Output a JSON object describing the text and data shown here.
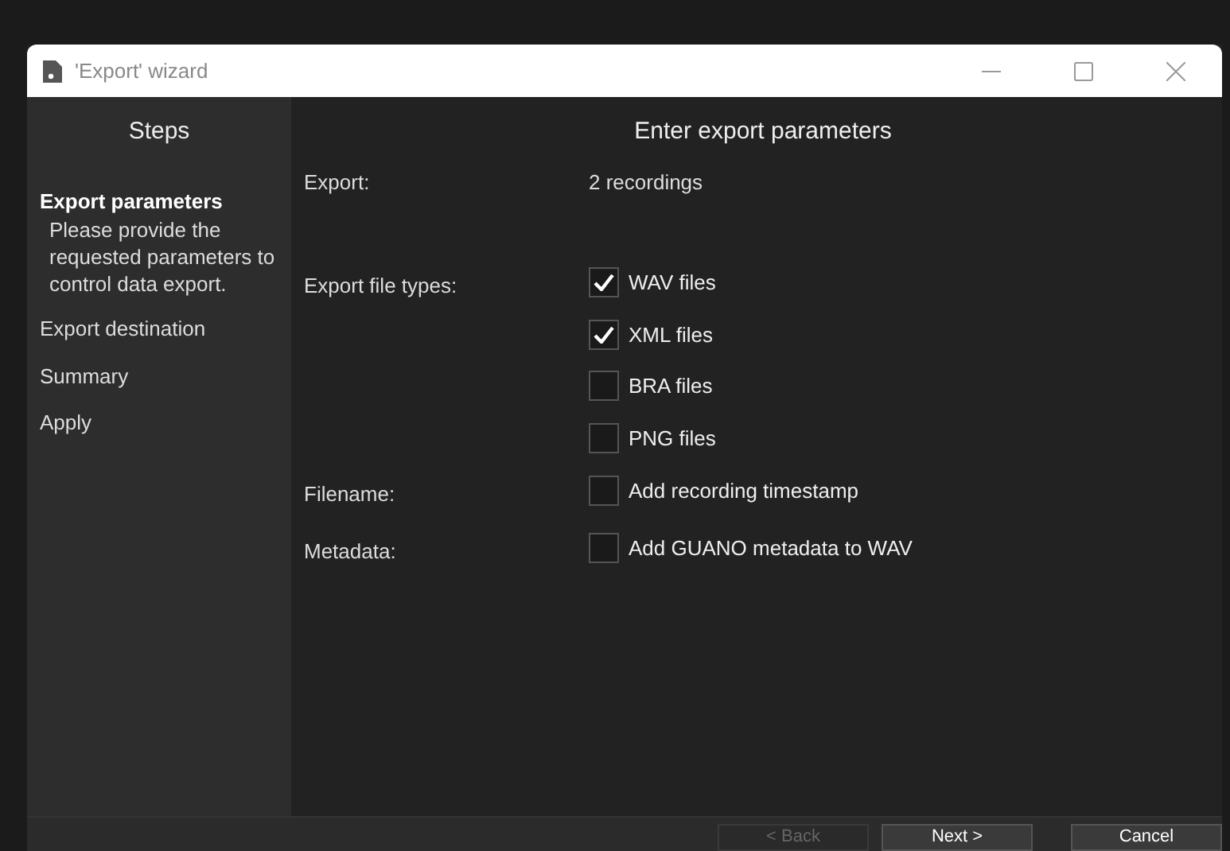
{
  "window": {
    "title": "'Export' wizard"
  },
  "steps_panel": {
    "title": "Steps",
    "items": [
      {
        "label": "Export parameters",
        "selected": true,
        "description": "Please provide the requested parameters to control data export."
      },
      {
        "label": "Export destination",
        "selected": false
      },
      {
        "label": "Summary",
        "selected": false
      },
      {
        "label": "Apply",
        "selected": false
      }
    ]
  },
  "main": {
    "heading": "Enter export parameters",
    "fields": [
      {
        "label": "Export:",
        "kind": "text",
        "value": "2 recordings"
      },
      {
        "label": "Export file types:",
        "kind": "checks",
        "options": [
          {
            "label": "WAV files",
            "checked": true
          },
          {
            "label": "XML files",
            "checked": true
          },
          {
            "label": "BRA files",
            "checked": false
          },
          {
            "label": "PNG files",
            "checked": false
          }
        ]
      },
      {
        "label": "Filename:",
        "kind": "checks",
        "options": [
          {
            "label": "Add recording timestamp",
            "checked": false
          }
        ]
      },
      {
        "label": "Metadata:",
        "kind": "checks",
        "options": [
          {
            "label": "Add GUANO metadata to WAV",
            "checked": false
          }
        ]
      }
    ]
  },
  "buttons": [
    {
      "label": "< Back",
      "disabled": true
    },
    {
      "label": "Next >",
      "disabled": false
    },
    {
      "label": "Cancel",
      "disabled": false
    }
  ]
}
